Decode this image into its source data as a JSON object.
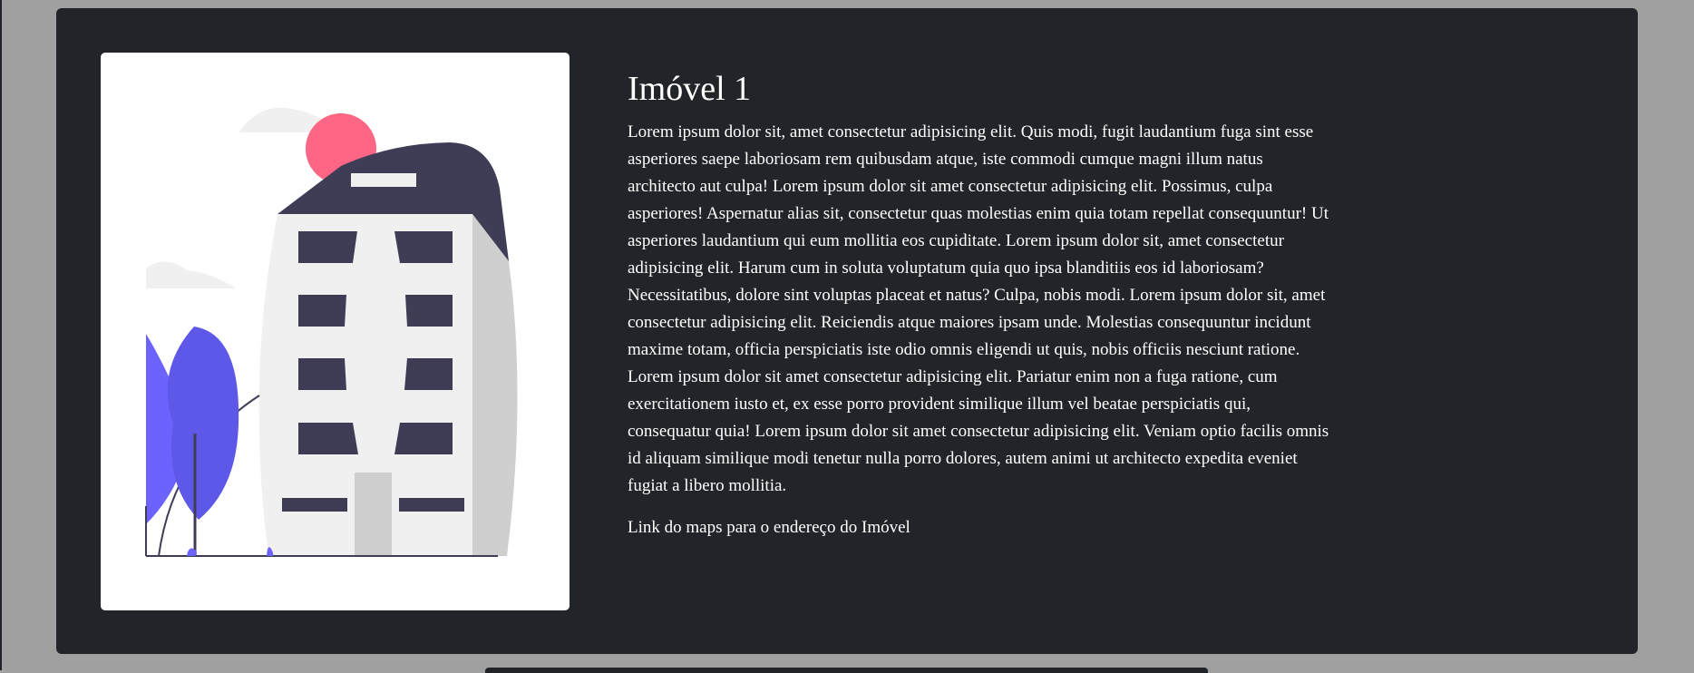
{
  "card": {
    "image": {
      "alt": "Ilustração de prédio"
    },
    "title": "Imóvel 1",
    "description": "Lorem ipsum dolor sit, amet consectetur adipisicing elit. Quis modi, fugit laudantium fuga sint esse asperiores saepe laboriosam rem quibusdam atque, iste commodi cumque magni illum natus architecto aut culpa! Lorem ipsum dolor sit amet consectetur adipisicing elit. Possimus, culpa asperiores! Aspernatur alias sit, consectetur quas molestias enim quia totam repellat consequuntur! Ut asperiores laudantium qui eum mollitia eos cupiditate. Lorem ipsum dolor sit, amet consectetur adipisicing elit. Harum cum in soluta voluptatum quia quo ipsa blanditiis eos id laboriosam? Necessitatibus, dolore sint voluptas placeat et natus? Culpa, nobis modi. Lorem ipsum dolor sit, amet consectetur adipisicing elit. Reiciendis atque maiores ipsam unde. Molestias consequuntur incidunt maxime totam, officia perspiciatis iste odio omnis eligendi ut quis, nobis officiis nesciunt ratione. Lorem ipsum dolor sit amet consectetur adipisicing elit. Pariatur enim non a fuga ratione, cum exercitationem iusto et, ex esse porro provident similique illum vel beatae perspiciatis qui, consequatur quia! Lorem ipsum dolor sit amet consectetur adipisicing elit. Veniam optio facilis omnis id aliquam similique modi tenetur nulla porro dolores, autem animi ut architecto expedita eveniet fugiat a libero mollitia.",
    "maps_link_label": "Link do maps para o endereço do Imóvel"
  },
  "colors": {
    "page_background": "#a0a0a0",
    "card_background": "#212529",
    "text": "#ffffff",
    "building_dark": "#3f3d56",
    "sun": "#ff6584",
    "tree": "#6c63ff"
  }
}
